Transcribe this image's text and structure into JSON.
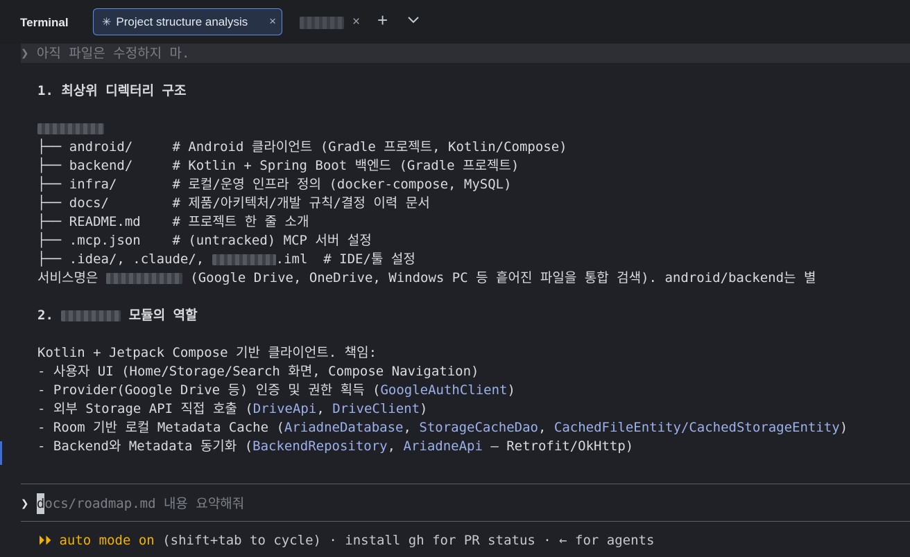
{
  "window": {
    "title": "Terminal"
  },
  "tabs": [
    {
      "label": "Project structure analysis",
      "spinner": "✳",
      "close": "×"
    },
    {
      "label": "",
      "close": "×"
    }
  ],
  "tabbar": {
    "new_tab": "+",
    "dropdown": "chevron-down-icon"
  },
  "previous_prompt": {
    "symbol": "❯",
    "text": "아직 파일은 수정하지 마."
  },
  "section1": {
    "heading": "1. 최상위 디렉터리 구조",
    "tree": [
      {
        "branch": "├── ",
        "name": "android/",
        "pad": "     ",
        "comment": "# Android 클라이언트 (Gradle 프로젝트, Kotlin/Compose)"
      },
      {
        "branch": "├── ",
        "name": "backend/",
        "pad": "     ",
        "comment": "# Kotlin + Spring Boot 백엔드 (Gradle 프로젝트)"
      },
      {
        "branch": "├── ",
        "name": "infra/",
        "pad": "       ",
        "comment": "# 로컬/운영 인프라 정의 (docker-compose, MySQL)"
      },
      {
        "branch": "├── ",
        "name": "docs/",
        "pad": "        ",
        "comment": "# 제품/아키텍처/개발 규칙/결정 이력 문서"
      },
      {
        "branch": "├── ",
        "name": "README.md",
        "pad": "    ",
        "comment": "# 프로젝트 한 줄 소개"
      },
      {
        "branch": "├── ",
        "name": ".mcp.json",
        "pad": "    ",
        "comment": "# (untracked) MCP 서버 설정"
      }
    ],
    "last_prefix": "├── .idea/, .claude/, ",
    "last_suffix": ".iml  # IDE/툴 설정",
    "service_prefix": "서비스명은 ",
    "service_suffix": " (Google Drive, OneDrive, Windows PC 등 흩어진 파일을 통합 검색). android/backend는 별"
  },
  "section2": {
    "heading_prefix": "2. ",
    "heading_suffix": " 모듈의 역할",
    "intro": "Kotlin + Jetpack Compose 기반 클라이언트. 책임:",
    "bullets": [
      {
        "text": "- 사용자 UI (Home/Storage/Search 화면, Compose Navigation)"
      },
      {
        "pre": "- Provider(Google Drive 등) 인증 및 권한 획득 (",
        "refs": [
          "GoogleAuthClient"
        ],
        "post": ")"
      },
      {
        "pre": "- 외부 Storage API 직접 호출 (",
        "refs": [
          "DriveApi",
          "DriveClient"
        ],
        "post": ")"
      },
      {
        "pre": "- Room 기반 로컬 Metadata Cache (",
        "refs": [
          "AriadneDatabase",
          "StorageCacheDao",
          "CachedFileEntity/CachedStorageEntity"
        ],
        "post": ")"
      },
      {
        "pre": "- Backend와 Metadata 동기화 (",
        "refs": [
          "BackendRepository",
          "AriadneApi"
        ],
        "post": " — Retrofit/OkHttp)"
      }
    ]
  },
  "input": {
    "prompt_symbol": "❯",
    "caret_char": "d",
    "placeholder": "ocs/roadmap.md 내용 요약해줘"
  },
  "status": {
    "arrows": "⏵⏵",
    "mode": "auto mode on",
    "rest": " (shift+tab to cycle) · install gh for PR status · ← for agents"
  },
  "colors": {
    "accent": "#f0b400",
    "link": "#9db1ea",
    "tab_border": "#5b8de6"
  }
}
